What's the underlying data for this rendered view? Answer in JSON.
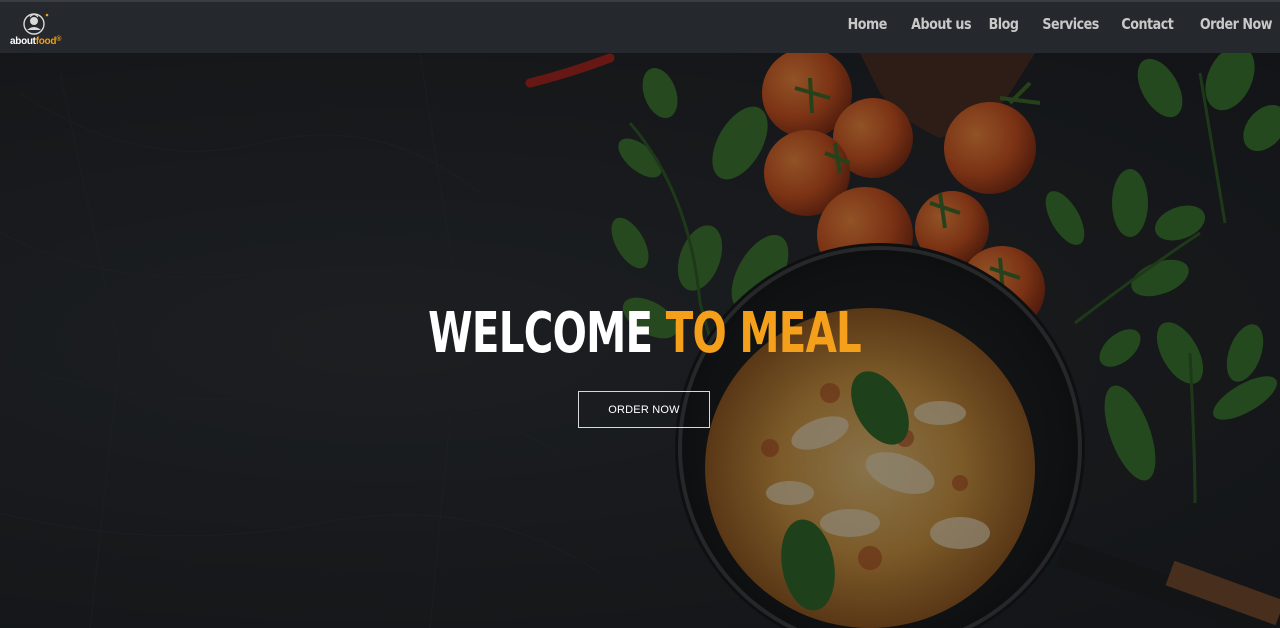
{
  "brand": {
    "logo_text_part1": "about",
    "logo_text_part2": "food",
    "accent_color": "#f5a01a"
  },
  "nav": {
    "items": [
      {
        "label": "Home"
      },
      {
        "label": "About us"
      },
      {
        "label": "Blog"
      },
      {
        "label": "Services"
      },
      {
        "label": "Contact"
      },
      {
        "label": "Order Now"
      }
    ]
  },
  "hero": {
    "title_white": "WELCOME ",
    "title_accent": "TO MEAL",
    "button_label": "ORDER NOW",
    "background_image": "dark-table-with-tomatoes-basil-and-pizza-pan"
  }
}
